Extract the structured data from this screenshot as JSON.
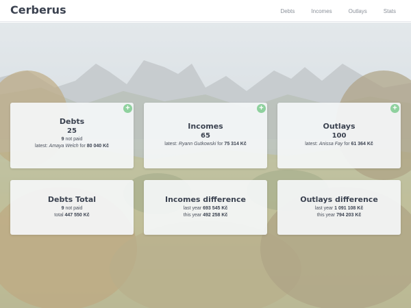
{
  "brand": "Cerberus",
  "nav": [
    {
      "label": "Debts"
    },
    {
      "label": "Incomes"
    },
    {
      "label": "Outlays"
    },
    {
      "label": "Stats"
    }
  ],
  "cards_top": {
    "debts": {
      "title": "Debts",
      "count": "25",
      "not_paid_count": "9",
      "not_paid_text": " not paid",
      "latest_prefix": "latest: ",
      "latest_name": "Amaya Welch",
      "for_text": " for ",
      "latest_amount": "80 040 Kč",
      "add": "+"
    },
    "incomes": {
      "title": "Incomes",
      "count": "65",
      "latest_prefix": "latest: ",
      "latest_name": "Ryann Gutkowski",
      "for_text": " for ",
      "latest_amount": "75 314 Kč",
      "add": "+"
    },
    "outlays": {
      "title": "Outlays",
      "count": "100",
      "latest_prefix": "latest: ",
      "latest_name": "Anissa Fay",
      "for_text": " for ",
      "latest_amount": "61 364 Kč",
      "add": "+"
    }
  },
  "cards_bottom": {
    "debts_total": {
      "title": "Debts Total",
      "not_paid_count": "9",
      "not_paid_text": " not paid",
      "total_prefix": "total ",
      "total_amount": "447 550 Kč"
    },
    "incomes_diff": {
      "title": "Incomes difference",
      "last_year_prefix": "last year ",
      "last_year_amount": "693 545 Kč",
      "this_year_prefix": "this year ",
      "this_year_amount": "492 258 Kč"
    },
    "outlays_diff": {
      "title": "Outlays difference",
      "last_year_prefix": "last year ",
      "last_year_amount": "1 091 108 Kč",
      "this_year_prefix": "this year ",
      "this_year_amount": "794 203 Kč"
    }
  }
}
